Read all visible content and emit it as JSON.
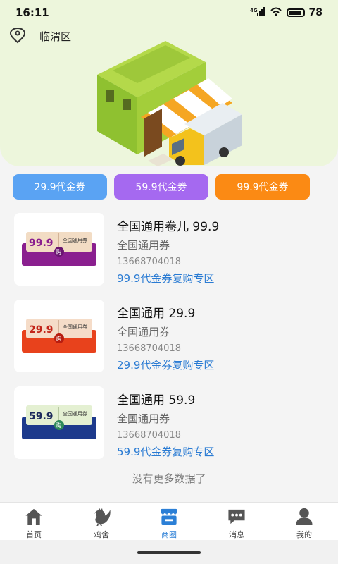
{
  "status_bar": {
    "time": "16:11",
    "network": "4G",
    "battery": "78"
  },
  "header": {
    "location": "临渭区"
  },
  "coupon_tabs": [
    {
      "label": "29.9代金券",
      "color": "#5aa3f3"
    },
    {
      "label": "59.9代金券",
      "color": "#a569f0"
    },
    {
      "label": "99.9代金券",
      "color": "#fb8a14"
    }
  ],
  "items": [
    {
      "badge_value": "99.9",
      "badge_text": "全国通用券",
      "badge_buy": "购",
      "title": "全国通用卷儿 99.9",
      "subtitle": "全国通用券",
      "phone": "13668704018",
      "link": "99.9代金券复购专区",
      "color": "#8a1f8f"
    },
    {
      "badge_value": "29.9",
      "badge_text": "全国通用券",
      "badge_buy": "购",
      "title": "全国通用 29.9",
      "subtitle": "全国通用券",
      "phone": "13668704018",
      "link": "29.9代金券复购专区",
      "color": "#e8421c"
    },
    {
      "badge_value": "59.9",
      "badge_text": "全国通用券",
      "badge_buy": "购",
      "title": "全国通用 59.9",
      "subtitle": "全国通用券",
      "phone": "13668704018",
      "link": "59.9代金券复购专区",
      "color": "#1d3a8c"
    }
  ],
  "footer": {
    "no_more": "没有更多数据了"
  },
  "bottom_nav": [
    {
      "label": "首页",
      "icon": "home-icon"
    },
    {
      "label": "鸡舍",
      "icon": "rooster-icon"
    },
    {
      "label": "商圈",
      "icon": "shop-icon",
      "active": true
    },
    {
      "label": "消息",
      "icon": "message-icon"
    },
    {
      "label": "我的",
      "icon": "user-icon"
    }
  ],
  "colors": {
    "accent": "#2b7fd6",
    "hero_bg": "#edf6dc"
  }
}
